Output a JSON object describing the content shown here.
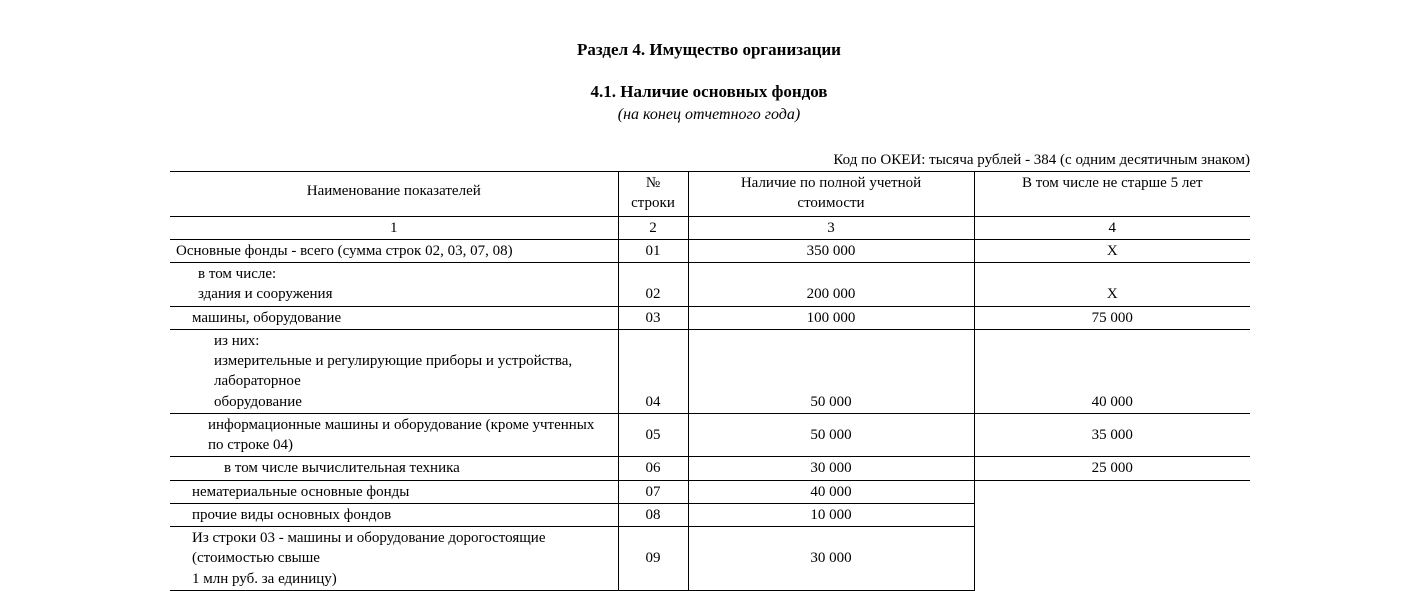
{
  "section_title": "Раздел 4. Имущество организации",
  "subsection_title": "4.1. Наличие основных фондов",
  "subtitle_italic": "(на конец отчетного года)",
  "okei_note": "Код по ОКЕИ: тысяча рублей - 384 (с одним десятичным знаком)",
  "headers": {
    "name": "Наименование показателей",
    "row_no_top": "№",
    "row_no_bottom": "строки",
    "full_value_top": "Наличие по полной учетной",
    "full_value_bottom": "стоимости",
    "age5": "В том числе не старше 5 лет"
  },
  "col_nums": {
    "c1": "1",
    "c2": "2",
    "c3": "3",
    "c4": "4"
  },
  "rows": {
    "r01": {
      "label": "Основные фонды - всего (сумма строк 02, 03, 07, 08)",
      "num": "01",
      "val": "350 000",
      "age": "Х"
    },
    "r_vtom": {
      "label": "в том числе:"
    },
    "r02": {
      "label": "здания и сооружения",
      "num": "02",
      "val": "200 000",
      "age": "Х"
    },
    "r03": {
      "label": "машины, оборудование",
      "num": "03",
      "val": "100 000",
      "age": "75 000"
    },
    "r_iznih": {
      "label": "из них:"
    },
    "r04a": {
      "label": "измерительные и регулирующие приборы и устройства, лабораторное"
    },
    "r04": {
      "label": "оборудование",
      "num": "04",
      "val": "50 000",
      "age": "40 000"
    },
    "r05": {
      "label": "информационные машины и оборудование (кроме учтенных по строке 04)",
      "num": "05",
      "val": "50 000",
      "age": "35 000"
    },
    "r06": {
      "label": "в том числе вычислительная техника",
      "num": "06",
      "val": "30 000",
      "age": "25 000"
    },
    "r07": {
      "label": "нематериальные основные фонды",
      "num": "07",
      "val": "40 000"
    },
    "r08": {
      "label": "прочие виды основных фондов",
      "num": "08",
      "val": "10 000"
    },
    "r09": {
      "label_l1": "Из строки 03 - машины и оборудование дорогостоящие (стоимостью свыше",
      "label_l2": "1 млн руб. за единицу)",
      "num": "09",
      "val": "30 000"
    }
  }
}
